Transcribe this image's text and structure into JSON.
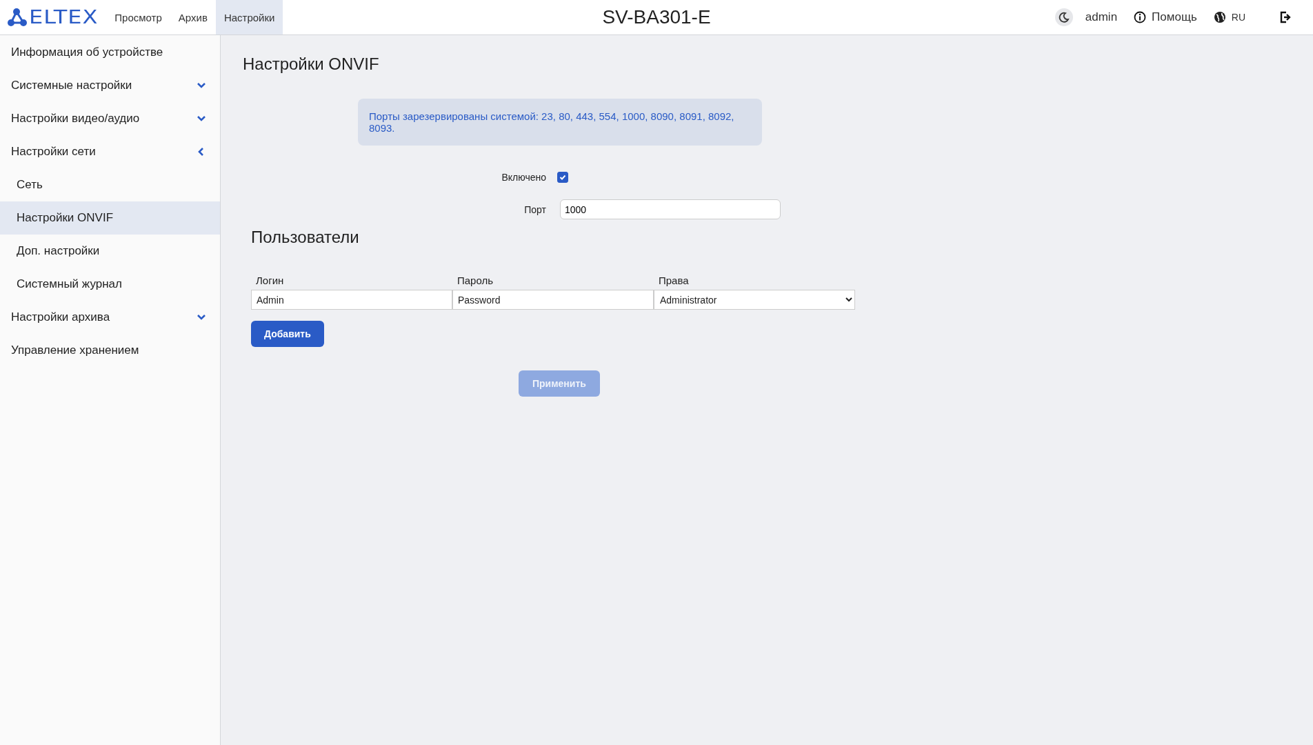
{
  "header": {
    "logo": "ELTEX",
    "nav": [
      {
        "label": "Просмотр",
        "selected": false
      },
      {
        "label": "Архив",
        "selected": false
      },
      {
        "label": "Настройки",
        "selected": true
      }
    ],
    "device": "SV-BA301-E",
    "user": "admin",
    "help": "Помощь",
    "language": "RU"
  },
  "sidebar": {
    "items": [
      {
        "kind": "link",
        "label": "Информация об устройстве",
        "selected": false
      },
      {
        "kind": "group",
        "label": "Системные настройки",
        "expanded": false
      },
      {
        "kind": "group",
        "label": "Настройки видео/аудио",
        "expanded": false
      },
      {
        "kind": "group",
        "label": "Настройки сети",
        "expanded": true,
        "children": [
          {
            "label": "Сеть",
            "selected": false
          },
          {
            "label": "Настройки ONVIF",
            "selected": true
          },
          {
            "label": "Доп. настройки",
            "selected": false
          },
          {
            "label": "Системный журнал",
            "selected": false
          }
        ]
      },
      {
        "kind": "group",
        "label": "Настройки архива",
        "expanded": false
      },
      {
        "kind": "link",
        "label": "Управление хранением",
        "selected": false
      }
    ]
  },
  "page": {
    "title": "Настройки ONVIF",
    "notice": "Порты зарезервированы системой: 23, 80, 443, 554, 1000, 8090, 8091, 8092, 8093.",
    "enabled": {
      "label": "Включено",
      "checked": true
    },
    "port": {
      "label": "Порт",
      "value": "1000"
    },
    "users": {
      "title": "Пользователи",
      "columns": [
        "Логин",
        "Пароль",
        "Права"
      ],
      "rows": [
        {
          "login": "Admin",
          "password": "Password",
          "rights": "Administrator"
        }
      ],
      "add_button": "Добавить"
    },
    "apply_button": {
      "label": "Применить",
      "disabled": true
    }
  }
}
